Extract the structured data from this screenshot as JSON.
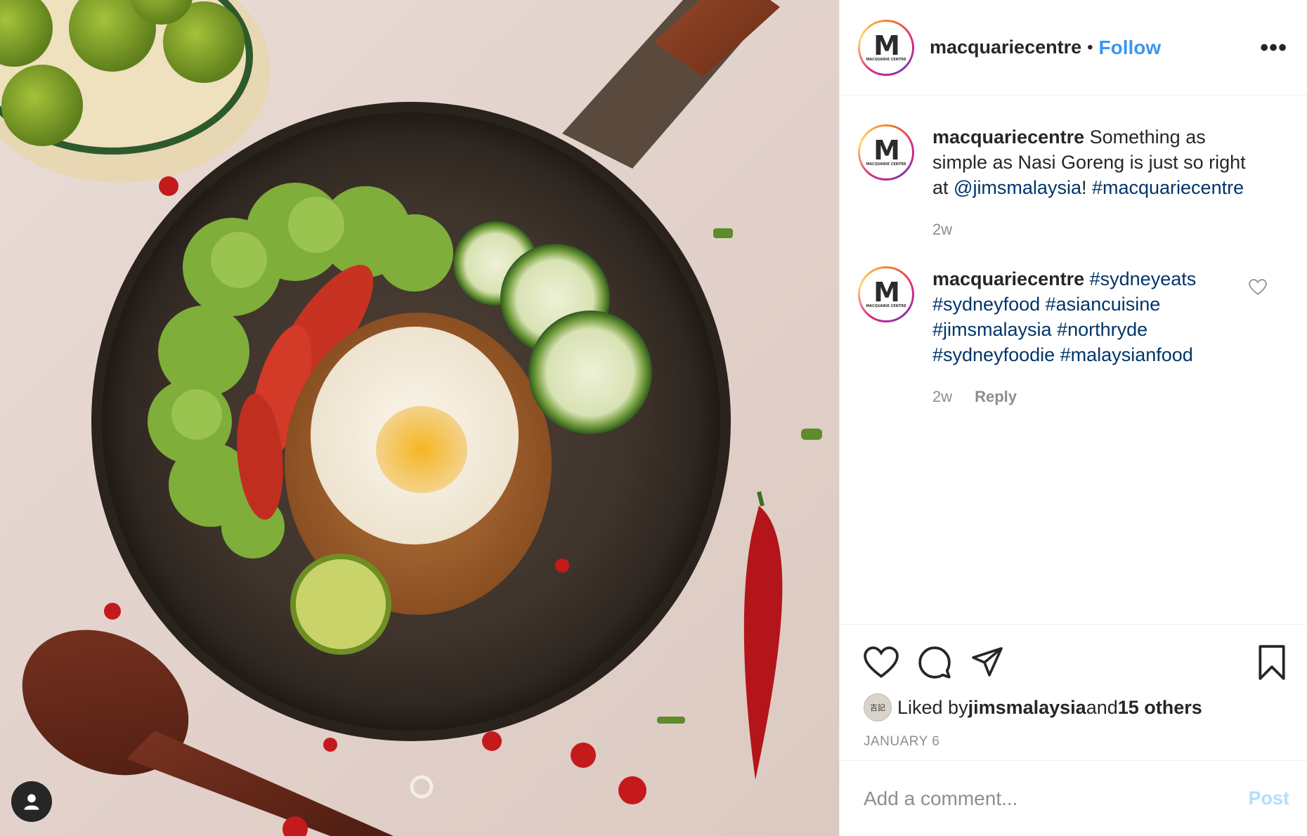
{
  "post": {
    "username": "macquariecentre",
    "separator": "•",
    "follow_label": "Follow",
    "more_label": "•••",
    "avatar_letter": "M",
    "avatar_subtext": "MACQUARIE CENTRE"
  },
  "comments": [
    {
      "username": "macquariecentre",
      "text_before": " Something as simple as Nasi Goreng is just so right at ",
      "mention": "@jimsmalaysia",
      "text_mid": "! ",
      "hashtag": "#macquariecentre",
      "time": "2w"
    },
    {
      "username": "macquariecentre",
      "tags": [
        "#sydneyeats",
        "#sydneyfood",
        "#asiancuisine",
        "#jimsmalaysia",
        "#northryde",
        "#sydneyfoodie",
        "#malaysianfood"
      ],
      "time": "2w",
      "reply_label": "Reply"
    }
  ],
  "likes": {
    "prefix": "Liked by ",
    "user": "jimsmalaysia",
    "middle": " and ",
    "others": "15 others",
    "liker_avatar_text": "吉記"
  },
  "date": "JANUARY 6",
  "add_comment": {
    "placeholder": "Add a comment...",
    "post_label": "Post"
  },
  "icons": {
    "like": "heart-icon",
    "comment": "comment-bubble-icon",
    "share": "paper-plane-icon",
    "save": "bookmark-icon",
    "user_tags": "person-icon"
  }
}
